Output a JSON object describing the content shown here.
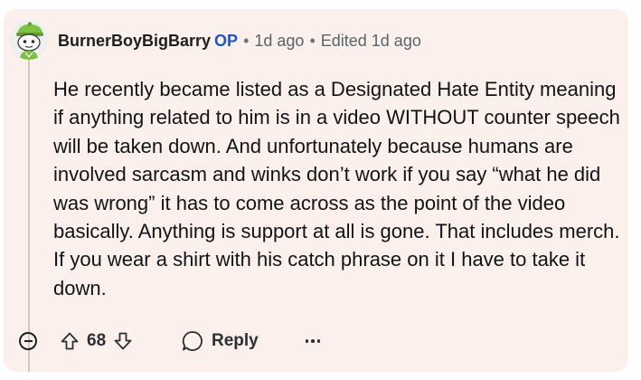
{
  "comment": {
    "username": "BurnerBoyBigBarry",
    "op_badge": "OP",
    "separator": "•",
    "posted_ago": "1d ago",
    "edited_label": "Edited 1d ago",
    "body": "He recently became listed as a Designated Hate Entity meaning if anything related to him is in a video WITHOUT counter speech will be taken down. And unfortunately because humans are involved sarcasm and winks don’t work if you say “what he did was wrong” it has to come across as the point of the video basically. Anything is support at all is gone. That includes merch. If you wear a shirt with his catch phrase on it I have to take it down."
  },
  "actions": {
    "collapse_icon": "minus-circle-icon",
    "upvote_icon": "arrow-up-icon",
    "score": "68",
    "downvote_icon": "arrow-down-icon",
    "reply_icon": "speech-bubble-icon",
    "reply_label": "Reply",
    "more_icon": "ellipsis-icon"
  },
  "colors": {
    "card_background": "#fbf0ec",
    "op_badge": "#1a56c8",
    "avatar_green": "#7ec241"
  }
}
